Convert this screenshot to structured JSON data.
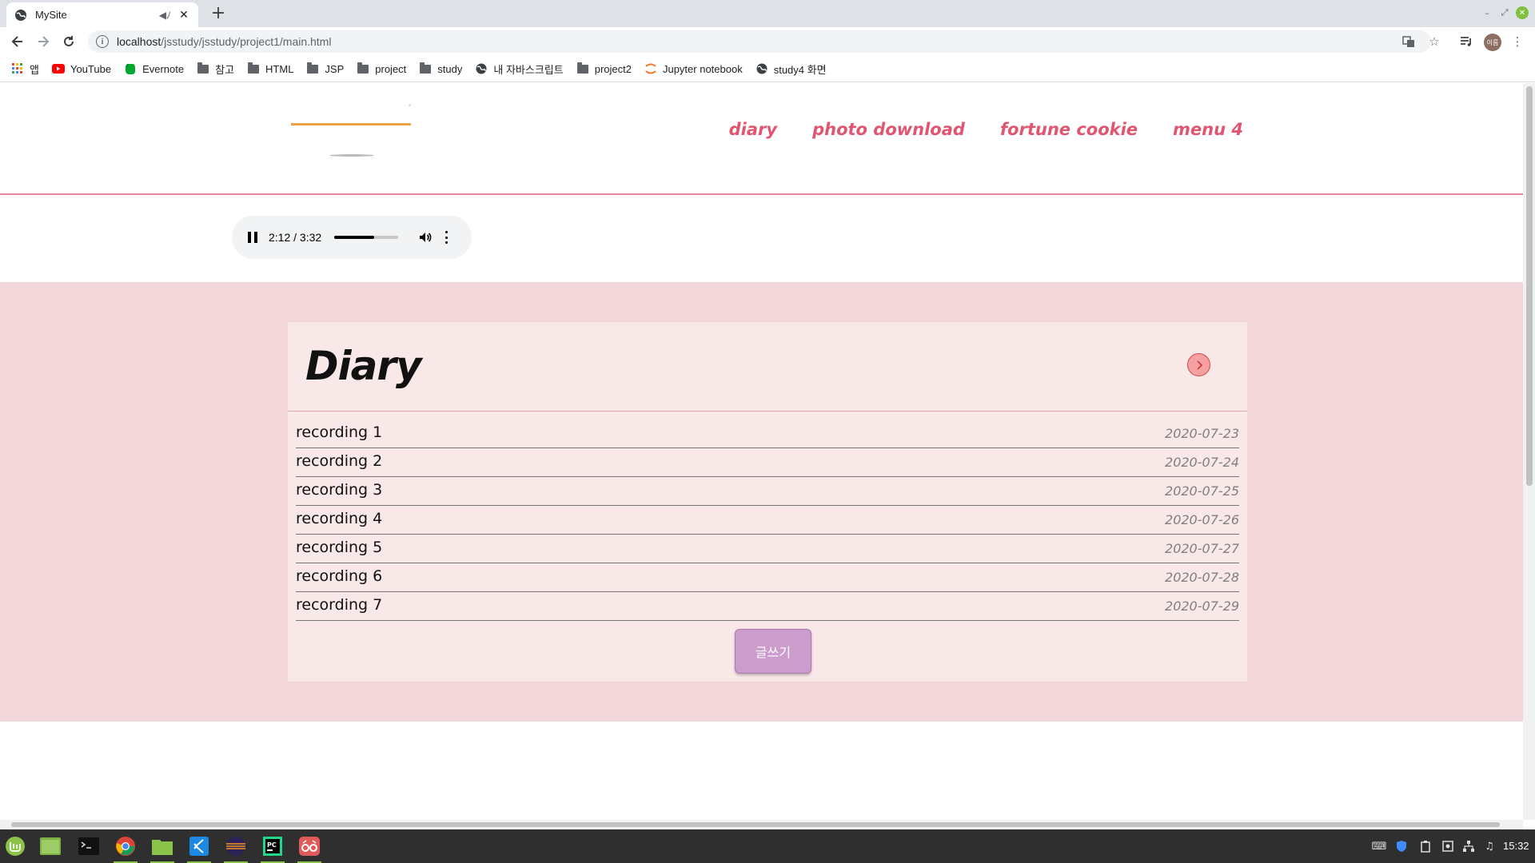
{
  "browser": {
    "tab_title": "MySite",
    "url_host": "localhost",
    "url_path": "/jsstudy/jsstudy/project1/main.html",
    "bookmarks": [
      {
        "label": "앱",
        "icon": "apps-grid-icon"
      },
      {
        "label": "YouTube",
        "icon": "youtube-icon"
      },
      {
        "label": "Evernote",
        "icon": "evernote-icon"
      },
      {
        "label": "참고",
        "icon": "folder-icon"
      },
      {
        "label": "HTML",
        "icon": "folder-icon"
      },
      {
        "label": "JSP",
        "icon": "folder-icon"
      },
      {
        "label": "project",
        "icon": "folder-icon"
      },
      {
        "label": "study",
        "icon": "folder-icon"
      },
      {
        "label": "내 자바스크립트",
        "icon": "globe-icon"
      },
      {
        "label": "project2",
        "icon": "folder-icon"
      },
      {
        "label": "Jupyter notebook",
        "icon": "jupyter-icon"
      },
      {
        "label": "study4 화면",
        "icon": "globe-icon"
      }
    ],
    "profile_label": "이름"
  },
  "site": {
    "nav": [
      "diary",
      "photo download",
      "fortune cookie",
      "menu 4"
    ],
    "accent_color": "#e05570",
    "logo_color": "#f0a04b"
  },
  "player": {
    "time": "2:12 / 3:32",
    "progress": 0.62
  },
  "diary": {
    "title": "Diary",
    "entries": [
      {
        "title": "recording 1",
        "date": "2020-07-23"
      },
      {
        "title": "recording 2",
        "date": "2020-07-24"
      },
      {
        "title": "recording 3",
        "date": "2020-07-25"
      },
      {
        "title": "recording 4",
        "date": "2020-07-26"
      },
      {
        "title": "recording 5",
        "date": "2020-07-27"
      },
      {
        "title": "recording 6",
        "date": "2020-07-28"
      },
      {
        "title": "recording 7",
        "date": "2020-07-29"
      }
    ],
    "write_button": "글쓰기",
    "band_color": "#f2d6d9",
    "card_color": "#f9e8e8",
    "button_color": "#cc9dcc"
  },
  "taskbar": {
    "clock": "15:32"
  }
}
